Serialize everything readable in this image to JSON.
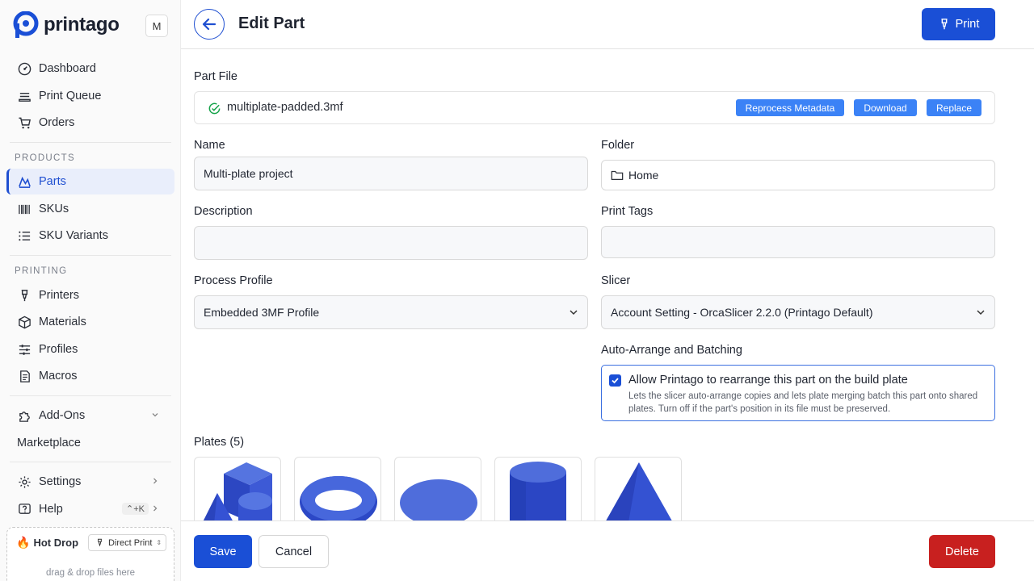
{
  "app": {
    "brand": "printago",
    "workspace_initial": "M"
  },
  "sidebar": {
    "items": [
      {
        "label": "Dashboard",
        "icon": "gauge-icon"
      },
      {
        "label": "Print Queue",
        "icon": "queue-icon"
      },
      {
        "label": "Orders",
        "icon": "cart-icon"
      }
    ],
    "products_section": "PRODUCTS",
    "products": [
      {
        "label": "Parts",
        "icon": "parts-icon",
        "active": true
      },
      {
        "label": "SKUs",
        "icon": "barcode-icon"
      },
      {
        "label": "SKU Variants",
        "icon": "list-icon"
      }
    ],
    "printing_section": "PRINTING",
    "printing": [
      {
        "label": "Printers",
        "icon": "nozzle-icon"
      },
      {
        "label": "Materials",
        "icon": "cube-icon"
      },
      {
        "label": "Profiles",
        "icon": "sliders-icon"
      },
      {
        "label": "Macros",
        "icon": "document-icon"
      }
    ],
    "addons_label": "Add-Ons",
    "marketplace_label": "Marketplace",
    "settings_label": "Settings",
    "help_label": "Help",
    "help_shortcut": "⌃+K",
    "hotdrop": {
      "title": "Hot Drop",
      "mode": "Direct Print",
      "hint": "drag & drop files here"
    }
  },
  "header": {
    "title": "Edit Part",
    "print_label": "Print"
  },
  "form": {
    "part_file_label": "Part File",
    "part_file_name": "multiplate-padded.3mf",
    "reprocess_label": "Reprocess Metadata",
    "download_label": "Download",
    "replace_label": "Replace",
    "name_label": "Name",
    "name_value": "Multi-plate project",
    "folder_label": "Folder",
    "folder_value": "Home",
    "description_label": "Description",
    "description_value": "",
    "print_tags_label": "Print Tags",
    "print_tags_value": "",
    "process_profile_label": "Process Profile",
    "process_profile_value": "Embedded 3MF Profile",
    "slicer_label": "Slicer",
    "slicer_value": "Account Setting - OrcaSlicer 2.2.0 (Printago Default)",
    "auto_arrange_label": "Auto-Arrange and Batching",
    "auto_arrange_checked": true,
    "auto_arrange_title": "Allow Printago to rearrange this part on the build plate",
    "auto_arrange_desc": "Lets the slicer auto-arrange copies and lets plate merging batch this part onto shared plates. Turn off if the part's position in its file must be preserved.",
    "plates_label": "Plates (5)",
    "plates": [
      {
        "shape": "mixed-shapes"
      },
      {
        "shape": "torus"
      },
      {
        "shape": "disc"
      },
      {
        "shape": "cylinder"
      },
      {
        "shape": "cone"
      }
    ]
  },
  "footer": {
    "save_label": "Save",
    "cancel_label": "Cancel",
    "delete_label": "Delete"
  },
  "colors": {
    "accent": "#1a4fd6",
    "accent_light": "#3b82f6",
    "danger": "#c8201f",
    "success": "#16a34a",
    "model_blue": "#3b5bd6"
  }
}
